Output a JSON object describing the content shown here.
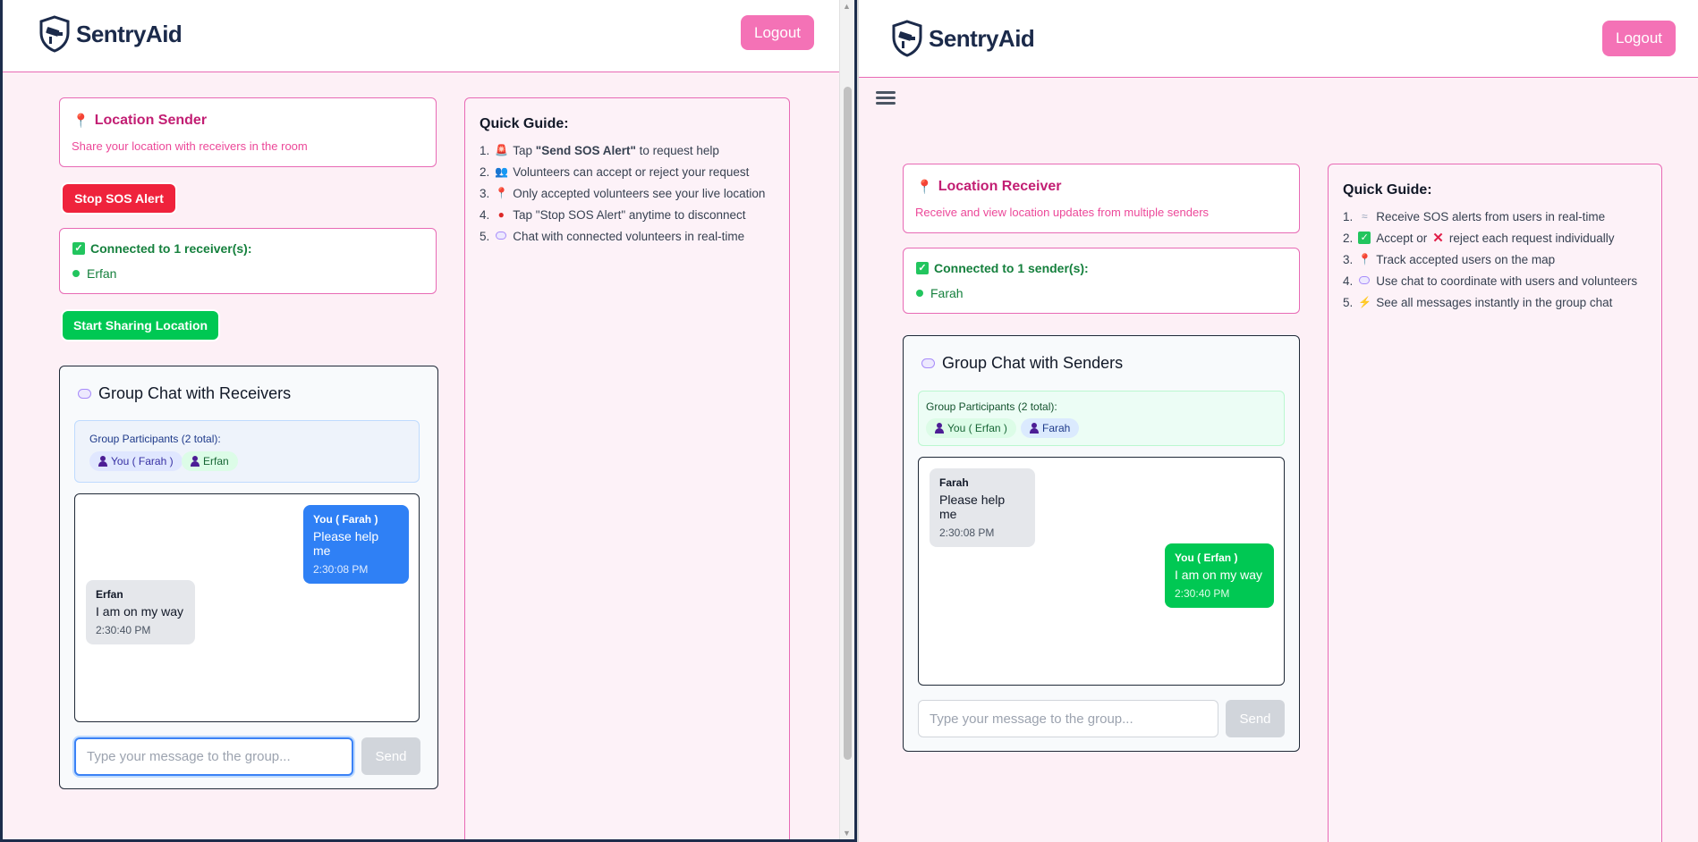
{
  "brand": "SentryAid",
  "logout_label": "Logout",
  "sender": {
    "card_title": "Location Sender",
    "card_sub": "Share your location with receivers in the room",
    "stop_button": "Stop SOS Alert",
    "connected_title": "Connected to 1 receiver(s):",
    "connected": [
      "Erfan"
    ],
    "share_button": "Start Sharing Location",
    "chat": {
      "title": "Group Chat with Receivers",
      "participants_title": "Group Participants (2 total):",
      "participants": [
        "You ( Farah )",
        "Erfan"
      ],
      "messages": [
        {
          "name": "You ( Farah )",
          "text": "Please help me",
          "time": "2:30:08 PM",
          "own": true
        },
        {
          "name": "Erfan",
          "text": "I am on my way",
          "time": "2:30:40 PM",
          "own": false
        }
      ],
      "placeholder": "Type your message to the group...",
      "send": "Send"
    },
    "guide": {
      "title": "Quick Guide:",
      "items": [
        {
          "num": "1.",
          "pre": "Tap ",
          "bold": "\"Send SOS Alert\"",
          "post": " to request help",
          "icon": "siren-icon"
        },
        {
          "num": "2.",
          "pre": "Volunteers can accept or reject your request",
          "bold": "",
          "post": "",
          "icon": "people-icon"
        },
        {
          "num": "3.",
          "pre": "Only accepted volunteers see your live location",
          "bold": "",
          "post": "",
          "icon": "pin-icon"
        },
        {
          "num": "4.",
          "pre": "Tap \"Stop SOS Alert\" anytime to disconnect",
          "bold": "",
          "post": "",
          "icon": "stop-icon"
        },
        {
          "num": "5.",
          "pre": "Chat with connected volunteers in real-time",
          "bold": "",
          "post": "",
          "icon": "chat-icon"
        }
      ]
    }
  },
  "receiver": {
    "card_title": "Location Receiver",
    "card_sub": "Receive and view location updates from multiple senders",
    "connected_title": "Connected to 1 sender(s):",
    "connected": [
      "Farah"
    ],
    "chat": {
      "title": "Group Chat with Senders",
      "participants_title": "Group Participants (2 total):",
      "participants": [
        "You ( Erfan )",
        "Farah"
      ],
      "messages": [
        {
          "name": "Farah",
          "text": "Please help me",
          "time": "2:30:08 PM",
          "own": false
        },
        {
          "name": "You ( Erfan )",
          "text": "I am on my way",
          "time": "2:30:40 PM",
          "own": true
        }
      ],
      "placeholder": "Type your message to the group...",
      "send": "Send"
    },
    "guide": {
      "title": "Quick Guide:",
      "items": [
        {
          "num": "1.",
          "pre": "Receive SOS alerts from users in real-time",
          "icon": "alert-icon"
        },
        {
          "num": "2.",
          "pre": "Accept or ",
          "icon": "check-icon",
          "mid_icon": "cross-icon",
          "post": " reject each request individually"
        },
        {
          "num": "3.",
          "pre": "Track accepted users on the map",
          "icon": "pin-icon"
        },
        {
          "num": "4.",
          "pre": "Use chat to coordinate with users and volunteers",
          "icon": "chat-icon"
        },
        {
          "num": "5.",
          "pre": "See all messages instantly in the group chat",
          "icon": "lightning-icon"
        }
      ]
    }
  }
}
